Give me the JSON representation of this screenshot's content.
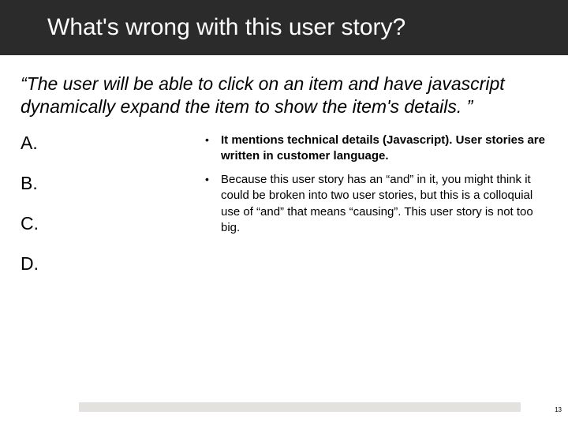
{
  "title": "What's wrong with this user story?",
  "quote": "“The user will be able to click on an item and have javascript dynamically expand the item to show the item's details. ”",
  "options": {
    "a": "A.",
    "b": "B.",
    "c": "C.",
    "d": "D."
  },
  "bullets": {
    "b1": "It mentions technical details (Javascript).  User stories are written in customer language.",
    "b2": "Because this user story has an “and” in it, you might think it could be broken into two user stories, but this is a colloquial use of “and” that means “causing”.  This user story is not too big."
  },
  "page_number": "13"
}
